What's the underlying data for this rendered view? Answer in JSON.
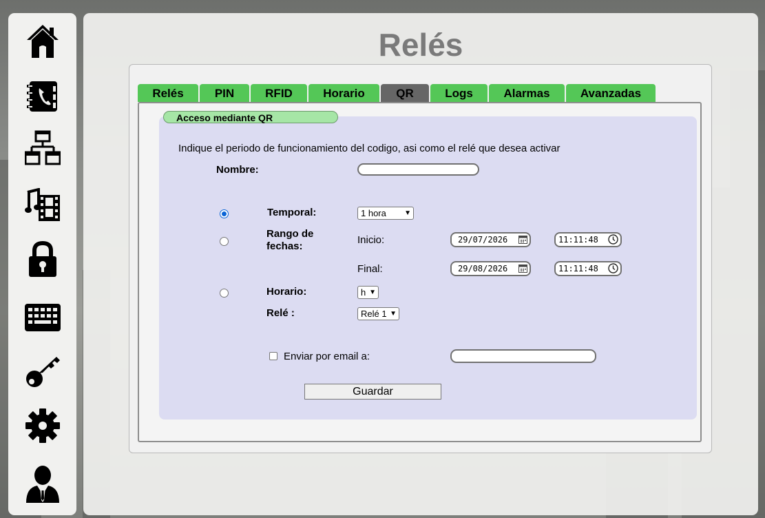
{
  "page_title": "Relés",
  "sidebar": {
    "items": [
      {
        "icon": "home-icon"
      },
      {
        "icon": "contacts-book-icon"
      },
      {
        "icon": "network-icon"
      },
      {
        "icon": "media-icon"
      },
      {
        "icon": "lock-icon"
      },
      {
        "icon": "keyboard-icon"
      },
      {
        "icon": "key-icon"
      },
      {
        "icon": "gear-icon"
      },
      {
        "icon": "user-icon"
      }
    ]
  },
  "tabs": [
    {
      "label": "Relés",
      "active": false
    },
    {
      "label": "PIN",
      "active": false
    },
    {
      "label": "RFID",
      "active": false
    },
    {
      "label": "Horario",
      "active": false
    },
    {
      "label": "QR",
      "active": true
    },
    {
      "label": "Logs",
      "active": false
    },
    {
      "label": "Alarmas",
      "active": false
    },
    {
      "label": "Avanzadas",
      "active": false
    }
  ],
  "form": {
    "section_label": "Acceso mediante QR",
    "intro": "Indique el periodo de funcionamiento del codigo, asi como el relé que desea activar",
    "nombre_label": "Nombre:",
    "nombre_value": "",
    "temporal_label": "Temporal:",
    "temporal_select": "1 hora",
    "rango_label_line1": "Rango de",
    "rango_label_line2": "fechas:",
    "inicio_label": "Inicio:",
    "inicio_date": "29/07/2026",
    "inicio_time": "11:11:48",
    "final_label": "Final:",
    "final_date": "29/08/2026",
    "final_time": "11:11:48",
    "horario_label": "Horario:",
    "horario_select": "h",
    "rele_label": "Relé :",
    "rele_select": "Relé 1",
    "email_label": "Enviar por email a:",
    "email_value": "",
    "email_checked": false,
    "selected_mode": "temporal",
    "save_label": "Guardar"
  },
  "colors": {
    "tab_green": "#54c757",
    "tab_active": "#666666",
    "section_green": "#a6e6a6",
    "inner_lavender": "#dcdcf2",
    "title_gray": "#7a7a7a"
  }
}
